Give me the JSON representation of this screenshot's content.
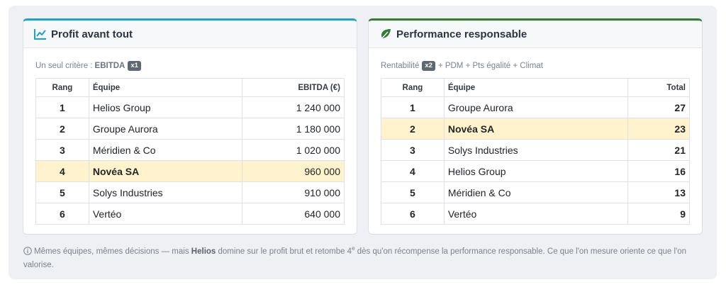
{
  "left_card": {
    "title": "Profit avant tout",
    "icon": "chart-line-icon",
    "accent_color": "#1ba3c6",
    "criteria_prefix": "Un seul critère :",
    "criteria_name": "EBITDA",
    "criteria_badge": "x1",
    "columns": [
      "Rang",
      "Équipe",
      "EBITDA (€)"
    ],
    "rows": [
      {
        "rank": "1",
        "team": "Helios Group",
        "value": "1 240 000",
        "highlight": false
      },
      {
        "rank": "2",
        "team": "Groupe Aurora",
        "value": "1 180 000",
        "highlight": false
      },
      {
        "rank": "3",
        "team": "Méridien & Co",
        "value": "1 020 000",
        "highlight": false
      },
      {
        "rank": "4",
        "team": "Novéa SA",
        "value": "960 000",
        "highlight": true
      },
      {
        "rank": "5",
        "team": "Solys Industries",
        "value": "910 000",
        "highlight": false
      },
      {
        "rank": "6",
        "team": "Vertéo",
        "value": "640 000",
        "highlight": false
      }
    ]
  },
  "right_card": {
    "title": "Performance responsable",
    "icon": "leaf-icon",
    "accent_color": "#2e7d32",
    "criteria_prefix": "Rentabilité",
    "criteria_badge": "x2",
    "criteria_suffix": "+ PDM + Pts égalité + Climat",
    "columns": [
      "Rang",
      "Équipe",
      "Total"
    ],
    "rows": [
      {
        "rank": "1",
        "team": "Groupe Aurora",
        "value": "27",
        "highlight": false
      },
      {
        "rank": "2",
        "team": "Novéa SA",
        "value": "23",
        "highlight": true
      },
      {
        "rank": "3",
        "team": "Solys Industries",
        "value": "21",
        "highlight": false
      },
      {
        "rank": "4",
        "team": "Helios Group",
        "value": "16",
        "highlight": false
      },
      {
        "rank": "5",
        "team": "Méridien & Co",
        "value": "13",
        "highlight": false
      },
      {
        "rank": "6",
        "team": "Vertéo",
        "value": "9",
        "highlight": false
      }
    ]
  },
  "footnote": {
    "icon": "info-circle-icon",
    "part1": "Mêmes équipes, mêmes décisions — mais",
    "strong": "Helios",
    "part2": "domine sur le profit brut et retombe 4",
    "sup": "e",
    "part3": "dès qu'on récompense la performance responsable. Ce que l'on mesure oriente ce que l'on valorise."
  },
  "colors": {
    "highlight_row": "#fff3cd",
    "badge": "#5f6770"
  }
}
